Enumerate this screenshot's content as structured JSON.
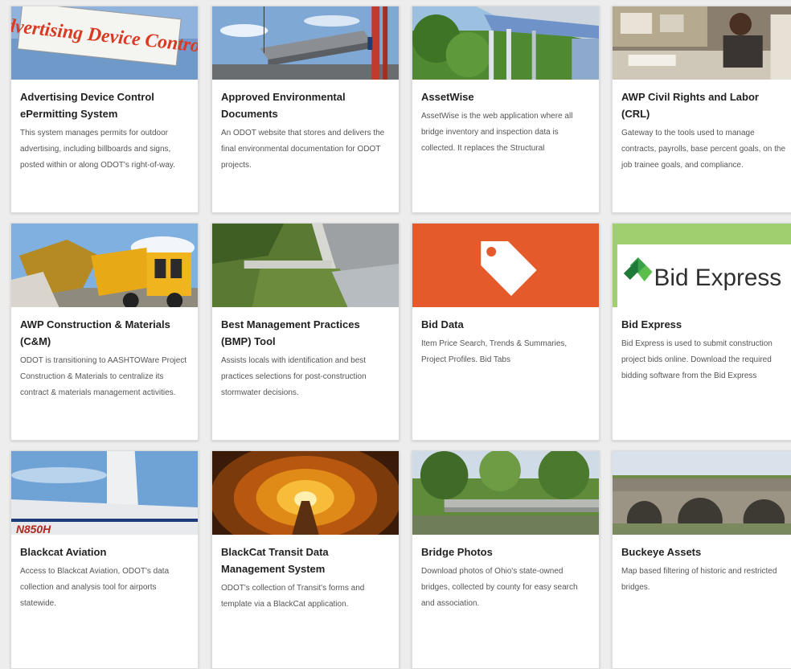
{
  "cards": [
    {
      "title": "Advertising Device Control ePermitting System",
      "description": "This system manages permits for outdoor advertising, including billboards and signs, posted within or along ODOT's right-of-way.",
      "image_text": "Advertising Device Control"
    },
    {
      "title": "Approved Environmental Documents",
      "description": "An ODOT website that stores and delivers the final environmental documentation for ODOT projects."
    },
    {
      "title": "AssetWise",
      "description": "AssetWise is the web application where all bridge inventory and inspection data is collected. It replaces the Structural"
    },
    {
      "title": "AWP Civil Rights and Labor (CRL)",
      "description": "Gateway to the tools used to manage contracts, payrolls, base percent goals, on the job trainee goals, and compliance."
    },
    {
      "title": "AWP Construction & Materials (C&M)",
      "description": "ODOT is transitioning to AASHTOWare Project Construction & Materials to centralize its contract & materials management activities."
    },
    {
      "title": "Best Management Practices (BMP) Tool",
      "description": "Assists locals with identification and best practices selections for post-construction stormwater decisions."
    },
    {
      "title": "Bid Data",
      "description": "Item Price Search, Trends & Summaries, Project Profiles. Bid Tabs",
      "image_icon": "price-tag-icon"
    },
    {
      "title": "Bid Express",
      "description": "Bid Express is used to submit construction project bids online. Download the required bidding software from the Bid Express",
      "image_text": "Bid Express"
    },
    {
      "title": "Blackcat Aviation",
      "description": "Access to Blackcat Aviation, ODOT's data collection and analysis tool for airports statewide.",
      "image_text": "N850H"
    },
    {
      "title": "BlackCat Transit Data Management System",
      "description": "ODOT's collection of Transit's forms and template via a BlackCat application."
    },
    {
      "title": "Bridge Photos",
      "description": "Download photos of Ohio's state-owned bridges, collected by county for easy search and association."
    },
    {
      "title": "Buckeye Assets",
      "description": "Map based filtering of historic and restricted bridges."
    }
  ]
}
